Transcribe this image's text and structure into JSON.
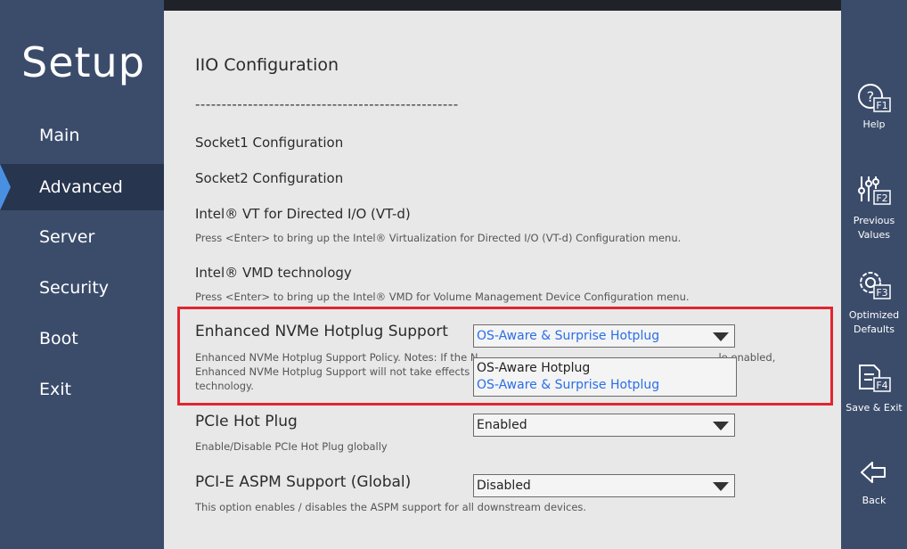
{
  "sidebar": {
    "title": "Setup",
    "items": [
      {
        "label": "Main",
        "active": false
      },
      {
        "label": "Advanced",
        "active": true
      },
      {
        "label": "Server",
        "active": false
      },
      {
        "label": "Security",
        "active": false
      },
      {
        "label": "Boot",
        "active": false
      },
      {
        "label": "Exit",
        "active": false
      }
    ]
  },
  "main": {
    "title": "IIO Configuration",
    "divider": "--------------------------------------------------",
    "links": [
      {
        "label": "Socket1 Configuration"
      },
      {
        "label": "Socket2 Configuration"
      },
      {
        "label": "Intel® VT for Directed I/O (VT-d)",
        "help": "Press <Enter> to bring up the Intel® Virtualization for Directed I/O (VT-d) Configuration menu."
      },
      {
        "label": "Intel® VMD technology",
        "help": "Press <Enter> to bring up the Intel® VMD for Volume Management Device Configuration menu."
      }
    ],
    "settings": [
      {
        "label": "Enhanced NVMe Hotplug Support",
        "value": "OS-Aware & Surprise Hotplug",
        "help_line1": "Enhanced NVMe Hotplug Support Policy. Notes: If the N",
        "help_line1b": "le enabled,",
        "help_line2": "Enhanced NVMe Hotplug Support will not take effects ar",
        "help_line3": "technology.",
        "dropdown_open": true,
        "options": [
          "OS-Aware Hotplug",
          "OS-Aware & Surprise Hotplug"
        ]
      },
      {
        "label": "PCIe Hot Plug",
        "value": "Enabled",
        "help": "Enable/Disable PCIe Hot Plug globally"
      },
      {
        "label": "PCI-E ASPM Support (Global)",
        "value": "Disabled",
        "help": "This option enables / disables the ASPM support for all downstream devices."
      }
    ]
  },
  "right_panel": {
    "buttons": [
      {
        "key": "F1",
        "label": "Help",
        "icon": "help-icon"
      },
      {
        "key": "F2",
        "label": "Previous\nValues",
        "icon": "sliders-icon"
      },
      {
        "key": "F3",
        "label": "Optimized\nDefaults",
        "icon": "gear-icon"
      },
      {
        "key": "F4",
        "label": "Save & Exit",
        "icon": "save-icon"
      },
      {
        "key": "",
        "label": "Back",
        "icon": "back-arrow-icon"
      }
    ]
  },
  "colors": {
    "sidebar_bg": "#3b4c6b",
    "active_bg": "#27354e",
    "accent": "#4a90e2",
    "selected_text": "#2a6ee8",
    "highlight_border": "#e0262e"
  }
}
